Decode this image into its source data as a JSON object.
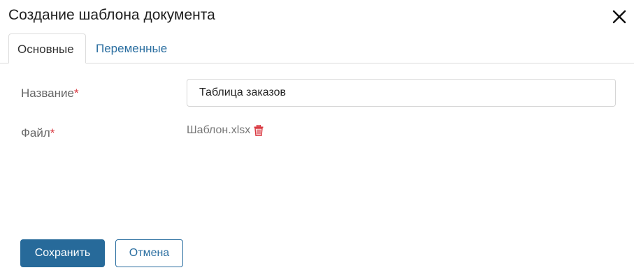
{
  "dialog": {
    "title": "Создание шаблона документа"
  },
  "tabs": [
    {
      "label": "Основные",
      "active": true
    },
    {
      "label": "Переменные",
      "active": false
    }
  ],
  "form": {
    "name": {
      "label": "Название",
      "required_mark": "*",
      "value": "Таблица заказов"
    },
    "file": {
      "label": "Файл",
      "required_mark": "*",
      "filename": "Шаблон.xlsx",
      "delete_icon": "trash-icon"
    }
  },
  "buttons": {
    "save_label": "Сохранить",
    "cancel_label": "Отмена"
  },
  "colors": {
    "accent": "#276a9a",
    "link": "#2a6ea0",
    "required": "#d9363e",
    "delete_icon": "#d9363e"
  }
}
